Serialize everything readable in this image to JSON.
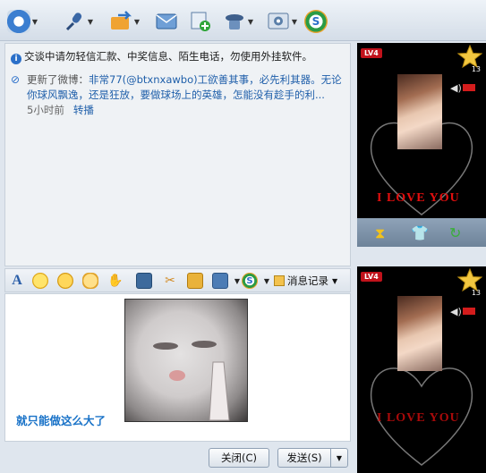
{
  "toolbar": {
    "icons": [
      {
        "name": "video-call-icon",
        "glyph": "◉",
        "color": "#3b7ed0"
      },
      {
        "name": "voice-call-icon",
        "glyph": "✎",
        "color": "#3967a8"
      },
      {
        "name": "send-file-icon",
        "glyph": "➜",
        "color": "#e88f1c"
      },
      {
        "name": "send-email-icon",
        "glyph": "✉",
        "color": "#4f89c4"
      },
      {
        "name": "add-app-icon",
        "glyph": "+",
        "color": "#2fa53a"
      },
      {
        "name": "remote-assist-icon",
        "glyph": "☺",
        "color": "#4d6e96"
      },
      {
        "name": "settings-icon",
        "glyph": "⚙",
        "color": "#5a7fa9"
      },
      {
        "name": "soso-icon",
        "glyph": "S",
        "color": "#2a9b46"
      }
    ]
  },
  "messages": {
    "notice": "交谈中请勿轻信汇款、中奖信息、陌生电话，勿使用外挂软件。",
    "weibo_prefix": "更新了微博：",
    "weibo_text": "非常77(@btxnxawbo)工欲善其事，必先利其器。无论你球风飘逸，还是狂放，要做球场上的英雄，怎能没有趁手的利...",
    "time": "5小时前",
    "repost": "转播"
  },
  "format_bar": {
    "icons": [
      "font-icon",
      "emoji-icon",
      "magic-face-icon",
      "gesture-icon",
      "poke-icon",
      "image-icon",
      "screenshot-icon",
      "gift-icon",
      "screen-capture-icon",
      "soso-ime-icon"
    ],
    "history_label": "消息记录"
  },
  "input": {
    "caption": "就只能做这么大了"
  },
  "buttons": {
    "close": "关闭(C)",
    "send": "发送(S)"
  },
  "panel1": {
    "level": "LV4",
    "star_count": "13",
    "love_text": "I LOVE YOU"
  },
  "panel2": {
    "level": "LV4",
    "star_count": "13",
    "love_text": "I LOVE YOU"
  }
}
